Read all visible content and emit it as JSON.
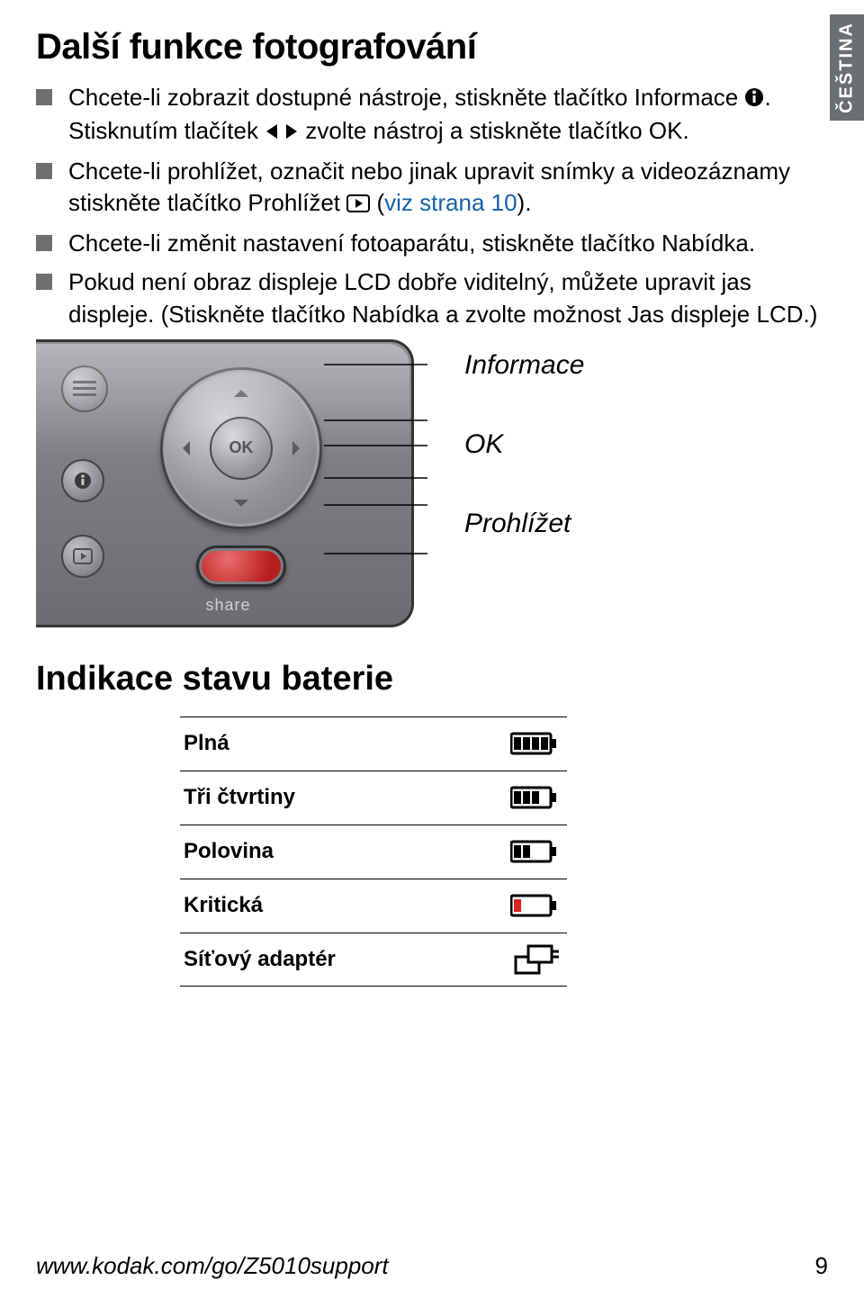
{
  "lang_tab": "ČEŠTINA",
  "title": "Další funkce fotografování",
  "bullets": [
    {
      "pre": "Chcete-li zobrazit dostupné nástroje, stiskněte tlačítko Informace ",
      "post": ". Stisknutím tlačítek ",
      "tail": " zvolte nástroj a stiskněte tlačítko OK."
    },
    {
      "pre": "Chcete-li prohlížet, označit nebo jinak upravit snímky a videozáznamy stiskněte tlačítko Prohlížet ",
      "mid_open": " (",
      "link": "viz strana 10",
      "mid_close": ")."
    },
    {
      "text": "Chcete-li změnit nastavení fotoaparátu, stiskněte tlačítko Nabídka."
    },
    {
      "text": "Pokud není obraz displeje LCD dobře viditelný, můžete upravit jas displeje. (Stiskněte tlačítko Nabídka a zvolte možnost Jas displeje LCD.)"
    }
  ],
  "callouts": {
    "info": "Informace",
    "ok": "OK",
    "review": "Prohlížet"
  },
  "camera": {
    "ok_label": "OK",
    "share_label": "share"
  },
  "battery_heading": "Indikace stavu baterie",
  "battery_levels": [
    {
      "label": "Plná",
      "segments": 4,
      "color": "#000"
    },
    {
      "label": "Tři čtvrtiny",
      "segments": 3,
      "color": "#000"
    },
    {
      "label": "Polovina",
      "segments": 2,
      "color": "#000"
    },
    {
      "label": "Kritická",
      "segments": 1,
      "color": "#d22"
    },
    {
      "label": "Síťový adaptér",
      "adapter": true
    }
  ],
  "footer_url": "www.kodak.com/go/Z5010support",
  "page_number": "9"
}
